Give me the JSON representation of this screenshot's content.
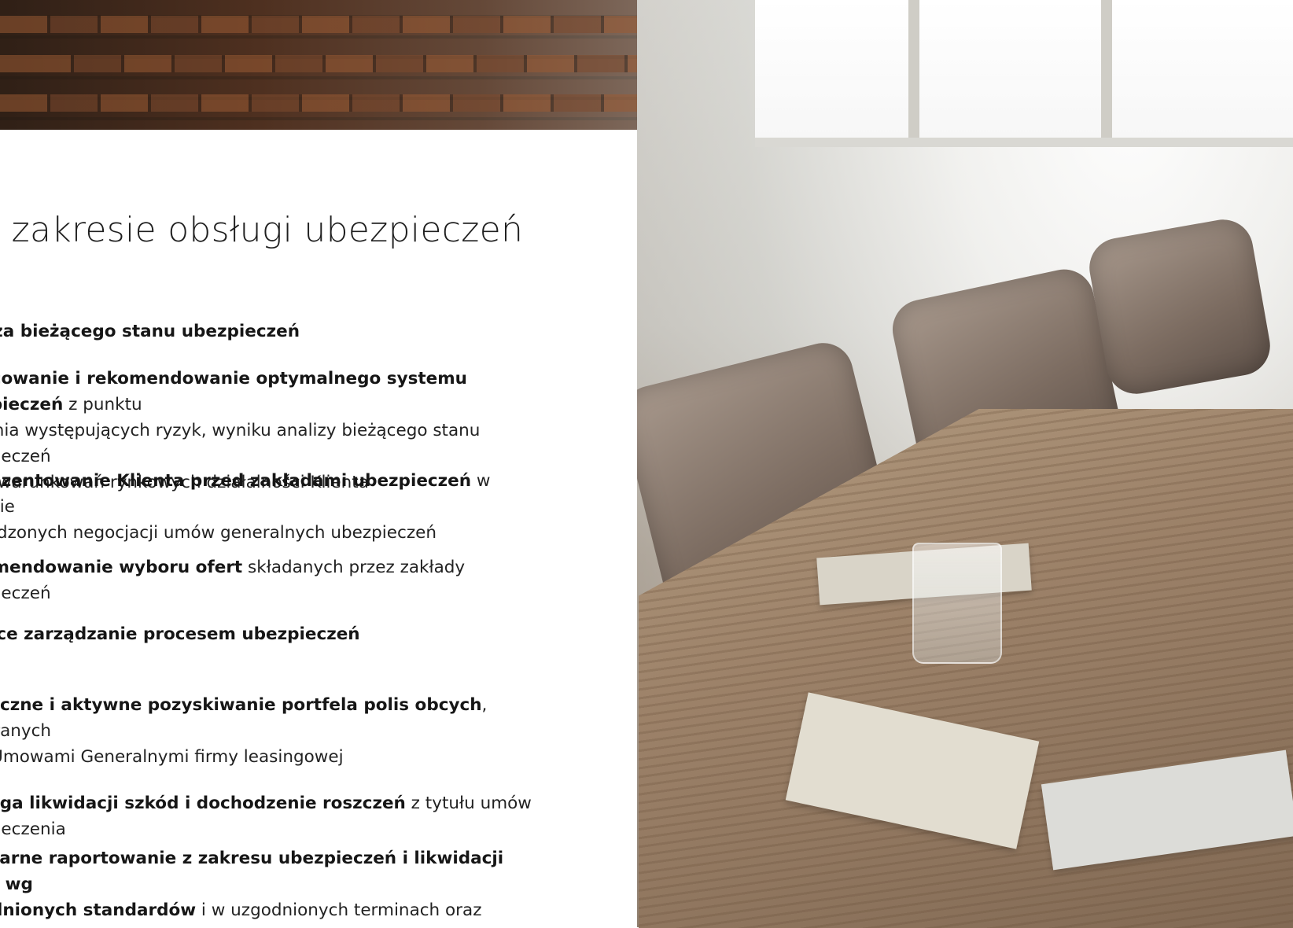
{
  "heading": "w zakresie obsługi ubezpieczeń",
  "items": [
    {
      "lines": [
        {
          "bold": "Analiza bieżącego stanu ubezpieczeń",
          "rest": ""
        }
      ]
    },
    {
      "lines": [
        {
          "bold": "Opracowanie i rekomendowanie optymalnego systemu ubezpieczeń",
          "rest": " z punktu"
        },
        {
          "bold": "",
          "rest": "widzenia występujących ryzyk, wyniku analizy bieżącego stanu ubezpieczeń"
        },
        {
          "bold": "",
          "rest": "oraz uwarunkowań rynkowych działalności Klienta"
        }
      ]
    },
    {
      "lines": [
        {
          "bold": "Reprezentowanie Klienta przed zakładami ubezpieczeń",
          "rest": " w zakresie"
        },
        {
          "bold": "",
          "rest": "prowadzonych negocjacji umów generalnych ubezpieczeń"
        }
      ]
    },
    {
      "lines": [
        {
          "bold": "Rekomendowanie wyboru ofert",
          "rest": " składanych przez zakłady ubezpieczeń"
        }
      ]
    },
    {
      "lines": [
        {
          "bold": "Bieżące zarządzanie procesem ubezpieczeń",
          "rest": ""
        }
      ]
    },
    {
      "lines": [
        {
          "bold": "Skuteczne i aktywne pozyskiwanie portfela polis obcych",
          "rest": ", zawieranych"
        },
        {
          "bold": "",
          "rest": "poza Umowami Generalnymi firmy leasingowej"
        }
      ]
    },
    {
      "lines": [
        {
          "bold": "Obsługa likwidacji szkód i dochodzenie roszczeń",
          "rest": " z tytułu umów ubezpieczenia"
        }
      ]
    },
    {
      "lines": [
        {
          "bold": "Regularne raportowanie z zakresu ubezpieczeń i likwidacji szkód wg",
          "rest": ""
        },
        {
          "bold": "uzgodnionych standardów",
          "rest": " i w uzgodnionych terminach oraz generowanie"
        }
      ]
    }
  ]
}
